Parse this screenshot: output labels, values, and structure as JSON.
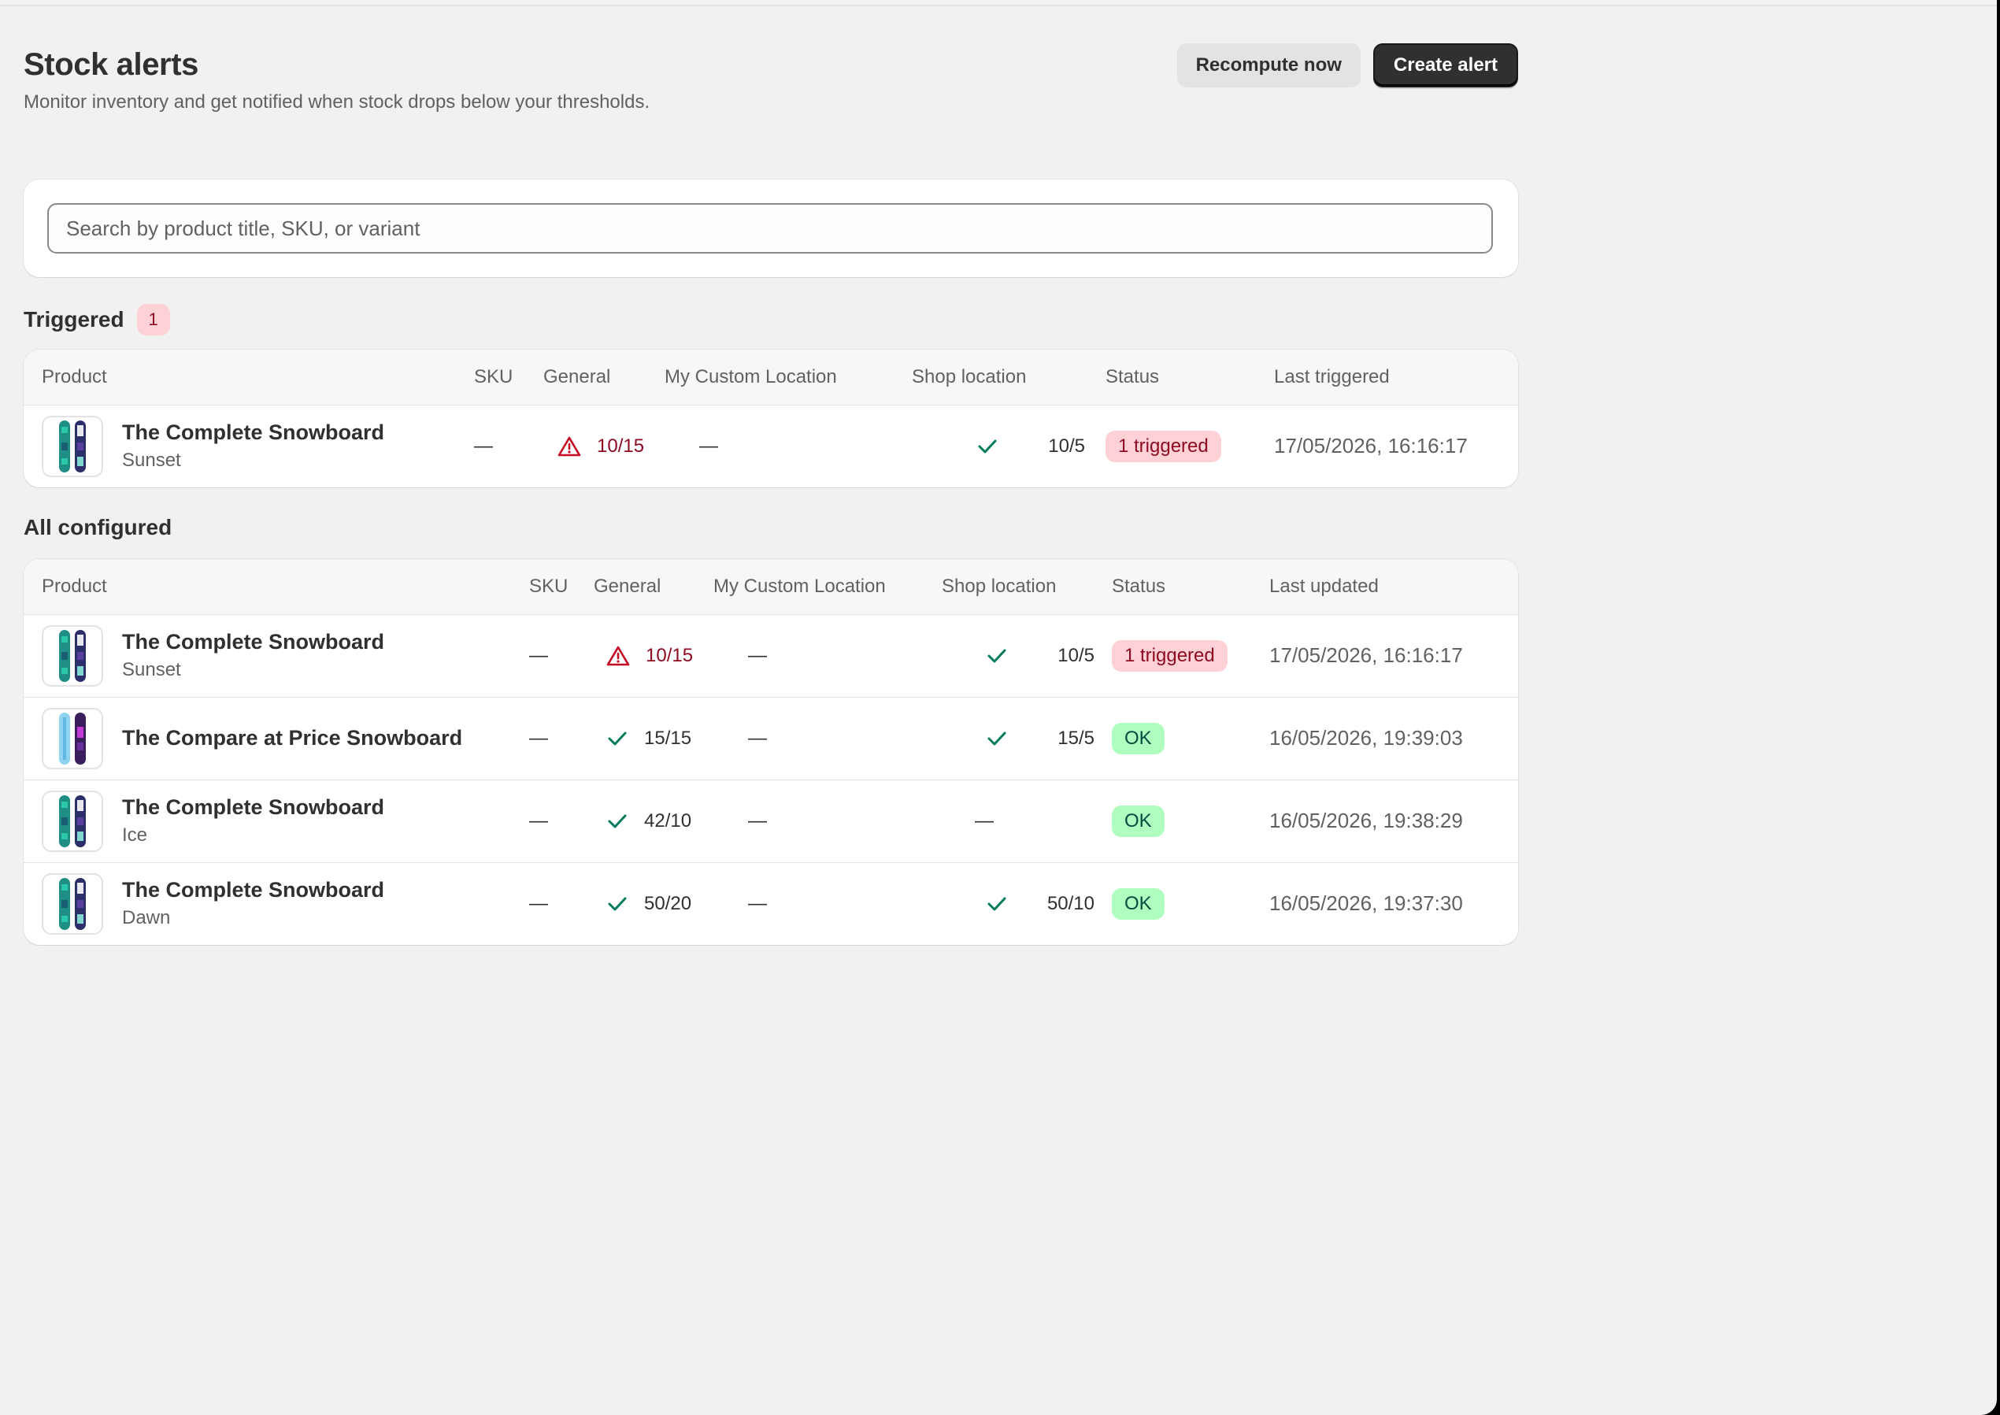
{
  "page": {
    "title": "Stock alerts",
    "subtitle": "Monitor inventory and get notified when stock drops below your thresholds."
  },
  "actions": {
    "recompute_label": "Recompute now",
    "create_label": "Create alert"
  },
  "search": {
    "placeholder": "Search by product title, SKU, or variant",
    "value": ""
  },
  "triggered": {
    "title": "Triggered",
    "count": "1",
    "columns": [
      "Product",
      "SKU",
      "General",
      "My Custom Location",
      "Shop location",
      "Status",
      "Last triggered"
    ],
    "rows": [
      {
        "thumb_icon": "snowboard-image",
        "title": "The Complete Snowboard",
        "variant": "Sunset",
        "sku": "—",
        "general": "10/15",
        "general_state": "warning",
        "custom_location": "—",
        "shop_location": "10/5",
        "shop_state": "ok",
        "status": "1 triggered",
        "status_type": "triggered",
        "time": "17/05/2026, 16:16:17"
      }
    ]
  },
  "configured": {
    "title": "All configured",
    "columns": [
      "Product",
      "SKU",
      "General",
      "My Custom Location",
      "Shop location",
      "Status",
      "Last updated"
    ],
    "rows": [
      {
        "thumb_icon": "snowboard-image",
        "title": "The Complete Snowboard",
        "variant": "Sunset",
        "sku": "—",
        "general": "10/15",
        "general_state": "warning",
        "custom_location": "—",
        "shop_location": "10/5",
        "shop_state": "ok",
        "status": "1 triggered",
        "status_type": "triggered",
        "time": "17/05/2026, 16:16:17"
      },
      {
        "thumb_icon": "snowboard-image",
        "title": "The Compare at Price Snowboard",
        "variant": "",
        "sku": "—",
        "general": "15/15",
        "general_state": "ok",
        "custom_location": "—",
        "shop_location": "15/5",
        "shop_state": "ok",
        "status": "OK",
        "status_type": "ok",
        "time": "16/05/2026, 19:39:03"
      },
      {
        "thumb_icon": "snowboard-image",
        "title": "The Complete Snowboard",
        "variant": "Ice",
        "sku": "—",
        "general": "42/10",
        "general_state": "ok",
        "custom_location": "—",
        "shop_location": "—",
        "shop_state": "none",
        "status": "OK",
        "status_type": "ok",
        "time": "16/05/2026, 19:38:29"
      },
      {
        "thumb_icon": "snowboard-image",
        "title": "The Complete Snowboard",
        "variant": "Dawn",
        "sku": "—",
        "general": "50/20",
        "general_state": "ok",
        "custom_location": "—",
        "shop_location": "50/10",
        "shop_state": "ok",
        "status": "OK",
        "status_type": "ok",
        "time": "16/05/2026, 19:37:30"
      }
    ]
  },
  "colors": {
    "background": "#f1f1f1",
    "critical_text": "#8e0b21",
    "critical_badge": "#fed1d7",
    "success_icon": "#047b5d",
    "success_badge": "#affebf",
    "primary_button": "#303030"
  }
}
